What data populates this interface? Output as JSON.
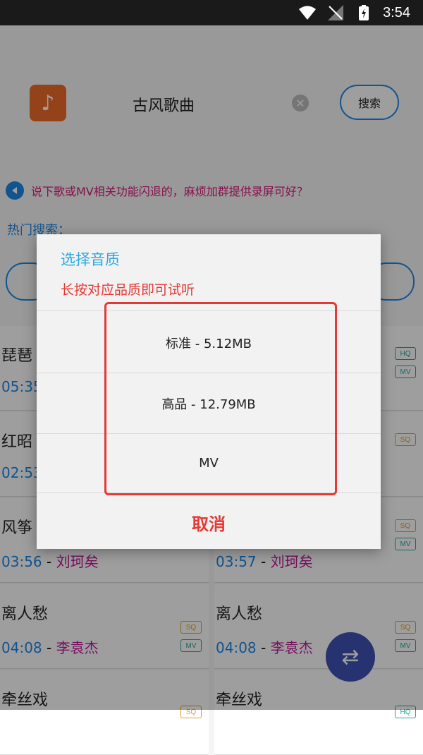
{
  "status_bar": {
    "time": "3:54"
  },
  "search": {
    "query": "古风歌曲",
    "button": "搜索"
  },
  "notice": {
    "text": "说下歌或MV相关功能闪退的，麻烦加群提供录屏可好？"
  },
  "hot": {
    "label": "热门搜索："
  },
  "songs": [
    {
      "title": "琵琶",
      "duration": "05:35",
      "artist": "",
      "tags": [
        "",
        ""
      ]
    },
    {
      "title": "",
      "duration": "",
      "artist": "",
      "tags": [
        "HQ",
        "MV"
      ]
    },
    {
      "title": "红昭",
      "duration": "02:53",
      "artist": "",
      "tags": [
        "",
        ""
      ]
    },
    {
      "title": "",
      "duration": "",
      "artist": "",
      "tags": [
        "SQ",
        ""
      ]
    },
    {
      "title": "风筝",
      "duration": "03:56",
      "artist": "刘珂矣",
      "tags": [
        "",
        ""
      ]
    },
    {
      "title": "",
      "duration": "03:57",
      "artist": "刘珂矣",
      "tags": [
        "SQ",
        "MV"
      ]
    },
    {
      "title": "离人愁",
      "duration": "04:08",
      "artist": "李袁杰",
      "tags": [
        "SQ",
        "MV"
      ]
    },
    {
      "title": "离人愁",
      "duration": "04:08",
      "artist": "李袁杰",
      "tags": [
        "SQ",
        "MV"
      ]
    },
    {
      "title": "牵丝戏",
      "duration": "",
      "artist": "",
      "tags": [
        "SQ",
        ""
      ]
    },
    {
      "title": "牵丝戏",
      "duration": "",
      "artist": "",
      "tags": [
        "HQ",
        ""
      ]
    }
  ],
  "dialog": {
    "title": "选择音质",
    "subtitle": "长按对应品质即可试听",
    "options": [
      "标准 - 5.12MB",
      "高品 - 12.79MB",
      "MV"
    ],
    "cancel": "取消"
  }
}
